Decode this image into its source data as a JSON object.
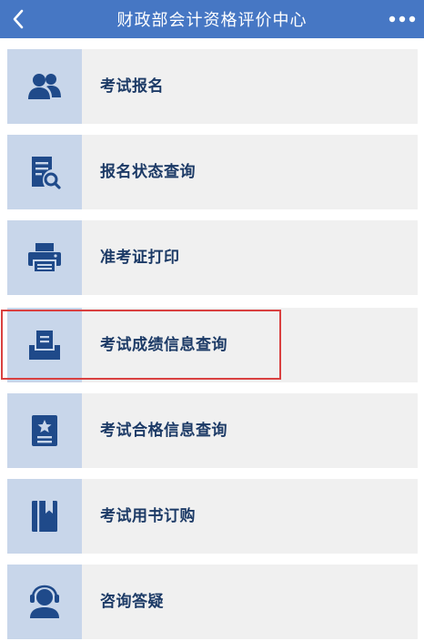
{
  "header": {
    "title": "财政部会计资格评价中心",
    "back_icon": "chevron-left-icon",
    "more_icon": "more-dots-icon"
  },
  "colors": {
    "header_bg": "#4677c4",
    "icon_bg": "#c8d6ea",
    "icon_fg": "#1f4a8a",
    "item_bg": "#f0f0f0",
    "label": "#1c3a66",
    "highlight": "#d94040"
  },
  "menu": {
    "items": [
      {
        "label": "考试报名",
        "icon": "users-icon"
      },
      {
        "label": "报名状态查询",
        "icon": "document-search-icon"
      },
      {
        "label": "准考证打印",
        "icon": "printer-icon"
      },
      {
        "label": "考试成绩信息查询",
        "icon": "inbox-tray-icon"
      },
      {
        "label": "考试合格信息查询",
        "icon": "certificate-icon"
      },
      {
        "label": "考试用书订购",
        "icon": "book-icon"
      },
      {
        "label": "咨询答疑",
        "icon": "headset-support-icon"
      }
    ],
    "highlighted_index": 3
  }
}
